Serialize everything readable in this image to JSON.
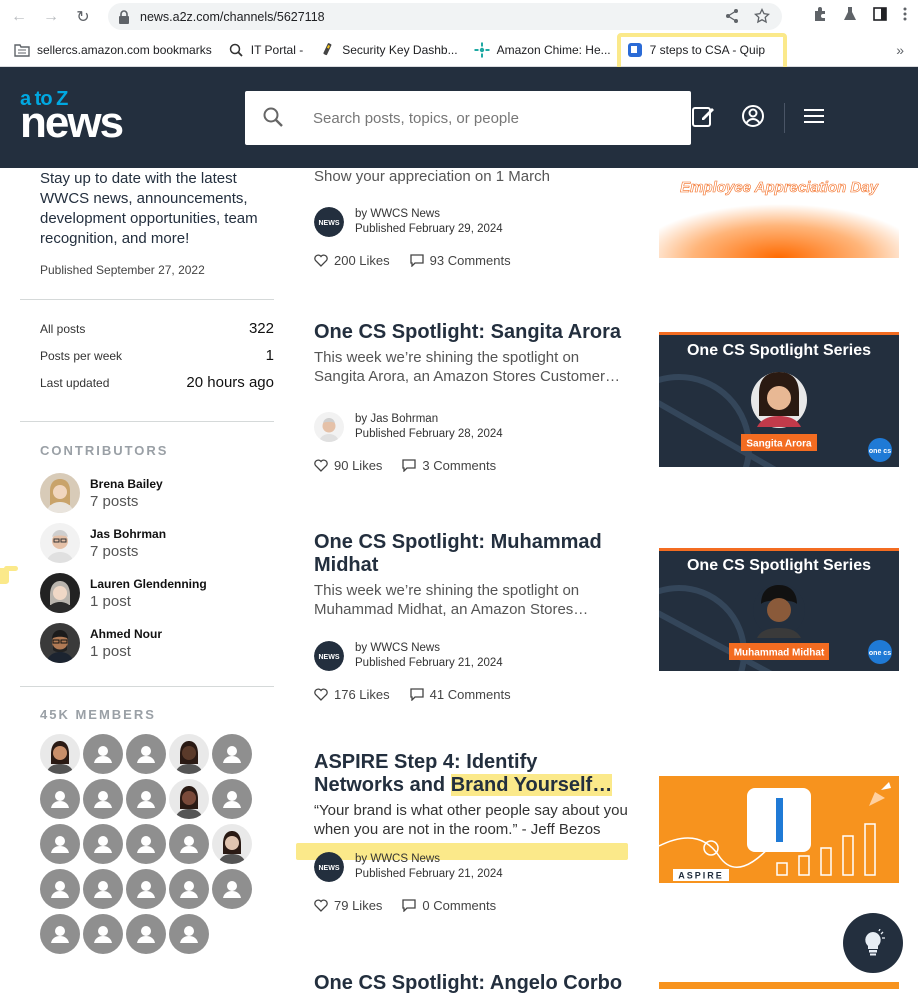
{
  "browser": {
    "url": "news.a2z.com/channels/5627118",
    "bookmarks": [
      {
        "label": "sellercs.amazon.com bookmarks"
      },
      {
        "label": "IT Portal -"
      },
      {
        "label": "Security Key Dashb..."
      },
      {
        "label": "Amazon Chime: He..."
      },
      {
        "label": "7 steps to CSA - Quip"
      }
    ]
  },
  "header": {
    "logo_atoz": "a to Z",
    "logo_news": "news",
    "search_placeholder": "Search posts, topics, or people"
  },
  "channel": {
    "description": "Stay up to date with the latest WWCS news, announcements, development opportunities, team recognition, and more!",
    "published": "Published September 27, 2022",
    "stats": [
      {
        "label": "All posts",
        "value": "322"
      },
      {
        "label": "Posts per week",
        "value": "1"
      },
      {
        "label": "Last updated",
        "value": "20 hours ago"
      }
    ]
  },
  "contributors": {
    "title": "CONTRIBUTORS",
    "items": [
      {
        "name": "Brena Bailey",
        "count": "7 posts"
      },
      {
        "name": "Jas Bohrman",
        "count": "7 posts"
      },
      {
        "name": "Lauren Glendenning",
        "count": "1 post"
      },
      {
        "name": "Ahmed Nour",
        "count": "1 post"
      }
    ]
  },
  "members": {
    "title": "45K MEMBERS"
  },
  "posts": [
    {
      "title": "",
      "excerpt": "Show your appreciation on 1 March",
      "author": "by WWCS News",
      "date": "Published February 29, 2024",
      "likes": "200 Likes",
      "comments": "93 Comments",
      "thumb_text": "Employee Appreciation Day"
    },
    {
      "title": "One CS Spotlight: Sangita Arora",
      "excerpt": "This week we’re shining the spotlight on Sangita Arora, an Amazon Stores Customer…",
      "author": "by Jas Bohrman",
      "date": "Published February 28, 2024",
      "likes": "90 Likes",
      "comments": "3 Comments",
      "thumb_title": "One CS Spotlight Series",
      "thumb_name": "Sangita Arora",
      "thumb_badge": "one cs"
    },
    {
      "title": "One CS Spotlight: Muhammad Midhat",
      "excerpt": "This week we’re shining the spotlight on Muhammad Midhat, an Amazon Stores…",
      "author": "by WWCS News",
      "date": "Published February 21, 2024",
      "likes": "176 Likes",
      "comments": "41 Comments",
      "thumb_title": "One CS Spotlight Series",
      "thumb_name": "Muhammad Midhat",
      "thumb_badge": "one cs"
    },
    {
      "title_line1": "ASPIRE Step 4: Identify",
      "title_line2a": "Networks and ",
      "title_line2b": "Brand Yourself…",
      "excerpt": "“Your brand is what other people say about you when you are not in the room.” - Jeff Bezos",
      "author": "by WWCS News",
      "date": "Published February 21, 2024",
      "likes": "79 Likes",
      "comments": "0 Comments",
      "thumb_label": "ASPIRE"
    },
    {
      "title": "One CS Spotlight: Angelo Corbo"
    }
  ],
  "colors": {
    "header_bg": "#232f3e",
    "accent_blue": "#00a8e1",
    "highlight": "#fbe98a",
    "aspire_orange": "#f7931e"
  }
}
